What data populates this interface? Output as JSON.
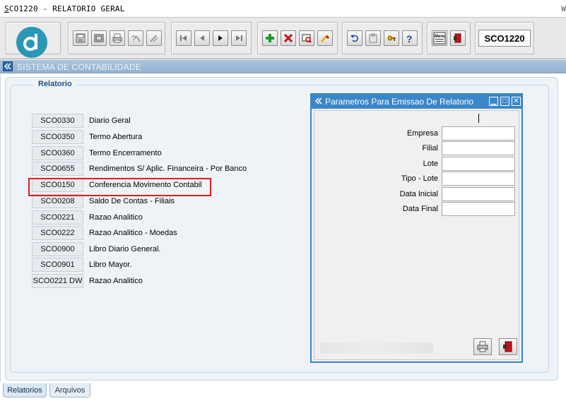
{
  "window": {
    "title_underlined": "S",
    "title_rest": "CO1220 - RELATORIO GERAL",
    "edge_text": "W"
  },
  "toolbar": {
    "module_code": "SCO1220",
    "icons": [
      "save-icon",
      "window-icon",
      "print-icon",
      "help-query-icon",
      "tools-icon",
      "first-record-icon",
      "previous-record-icon",
      "next-record-icon",
      "last-record-icon",
      "insert-record-icon",
      "delete-record-icon",
      "query-icon",
      "clear-icon",
      "undo-icon",
      "clipboard-icon",
      "key-icon",
      "help-icon",
      "menu-icon",
      "exit-icon"
    ],
    "menu_icon_text": "Menu"
  },
  "system": {
    "title": "SISTEMA DE CONTABILIDADE"
  },
  "reports": {
    "group_title": "Relatorio",
    "items": [
      {
        "code": "SCO0330",
        "desc": "Diario Geral"
      },
      {
        "code": "SCO0350",
        "desc": "Termo Abertura"
      },
      {
        "code": "SCO0360",
        "desc": "Termo Encerramento"
      },
      {
        "code": "SCO0655",
        "desc": "Rendimentos S/ Aplic. Financeira - Por Banco"
      },
      {
        "code": "SCO0150",
        "desc": "Conferencia Movimento Contabil"
      },
      {
        "code": "SCO0208",
        "desc": "Saldo De Contas - Filiais"
      },
      {
        "code": "SCO0221",
        "desc": "Razao Analitico"
      },
      {
        "code": "SCO0222",
        "desc": "Razao Analitico - Moedas"
      },
      {
        "code": "SCO0900",
        "desc": "Libro Diario General."
      },
      {
        "code": "SCO0901",
        "desc": "Libro Mayor."
      },
      {
        "code": "SCO0221 DW",
        "desc": "Razao Analitico"
      }
    ],
    "highlighted_code": "SCO0150"
  },
  "dialog": {
    "title": "Parametros Para Emissao De Relatorio",
    "fields": [
      {
        "label": "Empresa",
        "value": ""
      },
      {
        "label": "Filial",
        "value": ""
      },
      {
        "label": "Lote",
        "value": ""
      },
      {
        "label": "Tipo - Lote",
        "value": ""
      },
      {
        "label": "Data Inicial",
        "value": ""
      },
      {
        "label": "Data Final",
        "value": ""
      }
    ],
    "controls": {
      "minimize": "▁",
      "maximize": "□",
      "close": "✕"
    }
  },
  "tabs": [
    {
      "label": "Relatorios",
      "active": true
    },
    {
      "label": "Arquivos",
      "active": false
    }
  ],
  "colors": {
    "accent": "#3a86c8",
    "highlight": "#e21c1c",
    "logo": "#2a97b6"
  }
}
